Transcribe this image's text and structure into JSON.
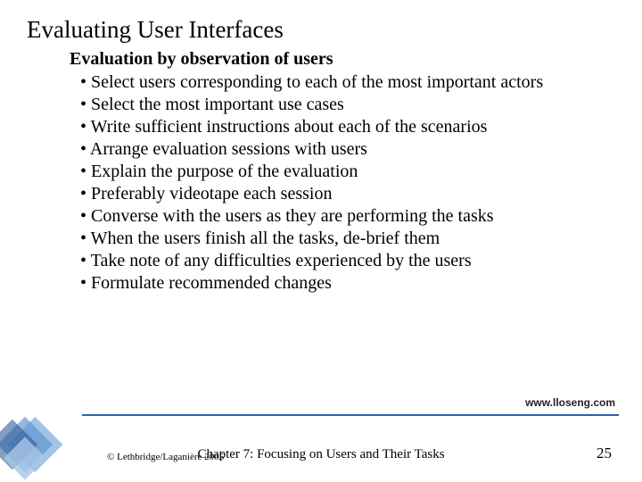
{
  "title": "Evaluating User Interfaces",
  "subtitle": "Evaluation by observation of users",
  "bullets": [
    "Select users corresponding to each of the most important actors",
    "Select the most important use cases",
    "Write sufficient instructions about each of the scenarios",
    "Arrange evaluation sessions with users",
    "Explain the purpose of the evaluation",
    "Preferably videotape each session",
    "Converse with the users as they are performing the tasks",
    "When the users finish all the tasks, de-brief them",
    "Take note of any difficulties experienced by the users",
    "Formulate recommended changes"
  ],
  "footer": {
    "url": "www.lloseng.com",
    "copyright": "© Lethbridge/Laganière 2005",
    "chapter": "Chapter 7: Focusing on Users and Their Tasks",
    "page": "25"
  }
}
